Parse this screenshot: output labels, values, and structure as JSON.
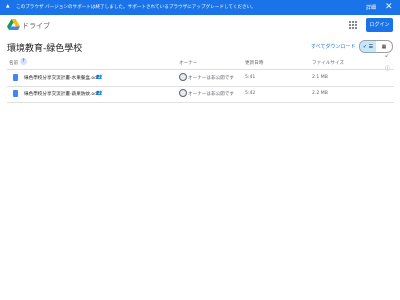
{
  "banner": {
    "message": "このブラウザ バージョンのサポートは終了しました。サポートされているブラウザにアップグレードしてください。",
    "details_label": "詳細",
    "close_symbol": "✕",
    "warning_symbol": "▲"
  },
  "header": {
    "app_name": "ドライブ",
    "login_label": "ログイン"
  },
  "folder": {
    "title": "環境教育-緑色學校",
    "download_all_label": "すべてダウンロード"
  },
  "view_toggle": {
    "list_symbol": "✓ ☰",
    "grid_symbol": "▦"
  },
  "columns": {
    "name": "名前",
    "sort_symbol": "↑",
    "owner": "オーナー",
    "modified": "更新日時",
    "size": "ファイルサイズ"
  },
  "files": [
    {
      "name": "綠色學校分享交流計畫-水果餐盒.odt",
      "owner": "オーナーは非公開です",
      "modified": "5:41",
      "size": "2.1 MB"
    },
    {
      "name": "綠色學校分享交流計畫-蔬果防蚊.odt",
      "owner": "オーナーは非公開です",
      "modified": "5:42",
      "size": "2.2 MB"
    }
  ],
  "colors": {
    "accent": "#1a73e8",
    "banner_bg": "#1a73e8",
    "toggle_active": "#c2e7ff",
    "file_icon": "#4285f4"
  },
  "icons": {
    "logo": "google-drive-logo",
    "apps": "grid-apps-icon",
    "shared": "people-icon"
  }
}
